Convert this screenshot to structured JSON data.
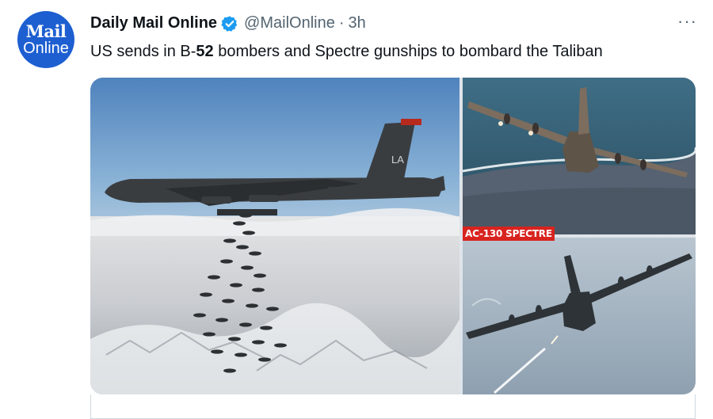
{
  "tweet": {
    "avatar_line1": "Mail",
    "avatar_line2": "Online",
    "author_name": "Daily Mail Online",
    "handle": "@MailOnline",
    "separator": "·",
    "time": "3h",
    "more_glyph": "···",
    "text_prefix": "US sends in B-",
    "text_bold": "52",
    "text_suffix": " bombers and Spectre gunships to bombard the Taliban",
    "verified_icon": "verified-badge-icon",
    "colors": {
      "brand_blue": "#1d5fd1",
      "verified": "#1d9bf0",
      "label_red": "#d8231f"
    }
  },
  "media": {
    "images": [
      {
        "subject": "b52-bomber-dropping-bombs"
      },
      {
        "subject": "ac130-gunship-over-coast"
      },
      {
        "subject": "ac130-gunship-firing-flares"
      }
    ],
    "overlay_label": "AC-130 SPECTRE"
  }
}
